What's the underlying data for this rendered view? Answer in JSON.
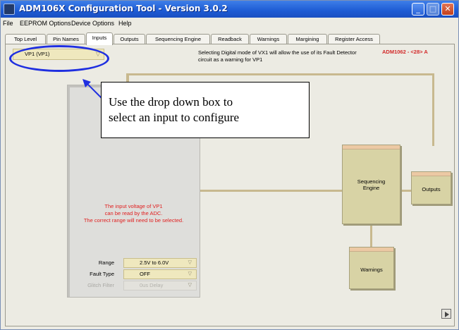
{
  "window": {
    "title": "ADM106X Configuration Tool - Version 3.0.2",
    "controls": {
      "minimize_icon": "minimize-icon",
      "maximize_icon": "maximize-icon",
      "close_icon": "close-icon",
      "close_glyph": "✕"
    }
  },
  "menu": [
    "File",
    "EEPROM Options",
    "Device Options",
    "Help"
  ],
  "tabs": [
    "Top Level",
    "Pin Names",
    "Inputs",
    "Outputs",
    "Sequencing Engine",
    "Readback",
    "Warnings",
    "Margining",
    "Register Access"
  ],
  "active_tab": "Inputs",
  "input_selector": {
    "value": "VP1 (VP1)",
    "arrow": "▽"
  },
  "info_text": "Selecting Digital mode of VX1 will allow the use of its Fault Detector circuit as a warning for VP1",
  "device_label": "ADM1062 - <28> A",
  "callout": {
    "line1": "Use the drop down box to",
    "line2": "select an input to configure"
  },
  "panel": {
    "message_line1": "The input voltage of VP1",
    "message_line2": "can be read by the ADC.",
    "message_line3": "The correct range will need to be selected.",
    "fields": [
      {
        "label": "Range",
        "value": "2.5V to 6.0V",
        "enabled": true
      },
      {
        "label": "Fault Type",
        "value": "OFF",
        "enabled": true
      },
      {
        "label": "Glitch Filter",
        "value": "0us Delay",
        "enabled": false
      }
    ]
  },
  "blocks": {
    "sequencing_engine_line1": "Sequencing",
    "sequencing_engine_line2": "Engine",
    "outputs": "Outputs",
    "warnings": "Warnings"
  },
  "colors": {
    "title_bar": "#1d5bd4",
    "oval": "#1f2fe0",
    "red_text": "#e02020",
    "block_fill": "#d8d3a5",
    "block_top": "#ecc9a4",
    "field_fill": "#efe8be"
  }
}
